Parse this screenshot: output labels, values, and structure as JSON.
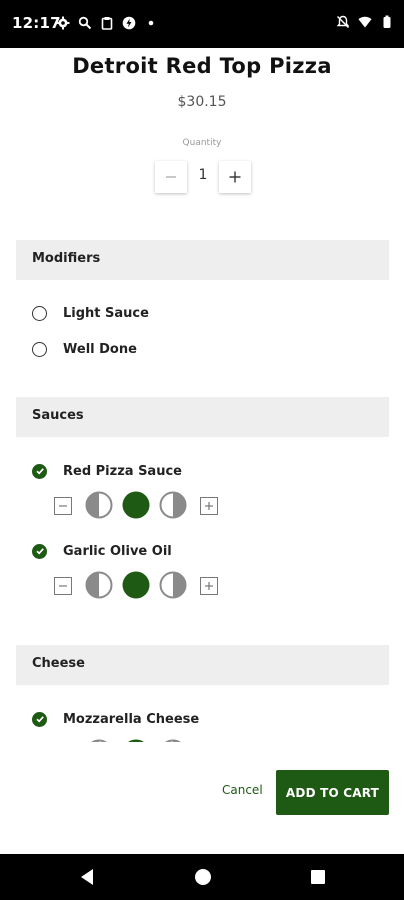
{
  "status_bar": {
    "time": "12:17",
    "left_icons": [
      "settings-icon",
      "search-icon",
      "clipboard-icon",
      "data-saver-icon",
      "dot-icon"
    ],
    "right_icons": [
      "notifications-off-icon",
      "wifi-icon",
      "battery-icon"
    ]
  },
  "item": {
    "title": "Detroit Red Top Pizza",
    "price": "$30.15"
  },
  "quantity": {
    "label": "Quantity",
    "value": "1",
    "minus": "−",
    "plus": "+"
  },
  "sections": {
    "modifiers": {
      "title": "Modifiers",
      "options": [
        {
          "label": "Light Sauce",
          "selected": false
        },
        {
          "label": "Well Done",
          "selected": false
        }
      ]
    },
    "sauces": {
      "title": "Sauces",
      "items": [
        {
          "label": "Red Pizza Sauce",
          "checked": true,
          "portion": "whole"
        },
        {
          "label": "Garlic Olive Oil",
          "checked": true,
          "portion": "whole"
        }
      ]
    },
    "cheese": {
      "title": "Cheese",
      "items": [
        {
          "label": "Mozzarella Cheese",
          "checked": true,
          "portion": "whole"
        }
      ]
    }
  },
  "footer": {
    "cancel": "Cancel",
    "add_to_cart": "ADD TO CART"
  },
  "colors": {
    "accent": "#1f5a14",
    "section_bg": "#eeeeee",
    "portion_gray": "#8a8a8a"
  }
}
